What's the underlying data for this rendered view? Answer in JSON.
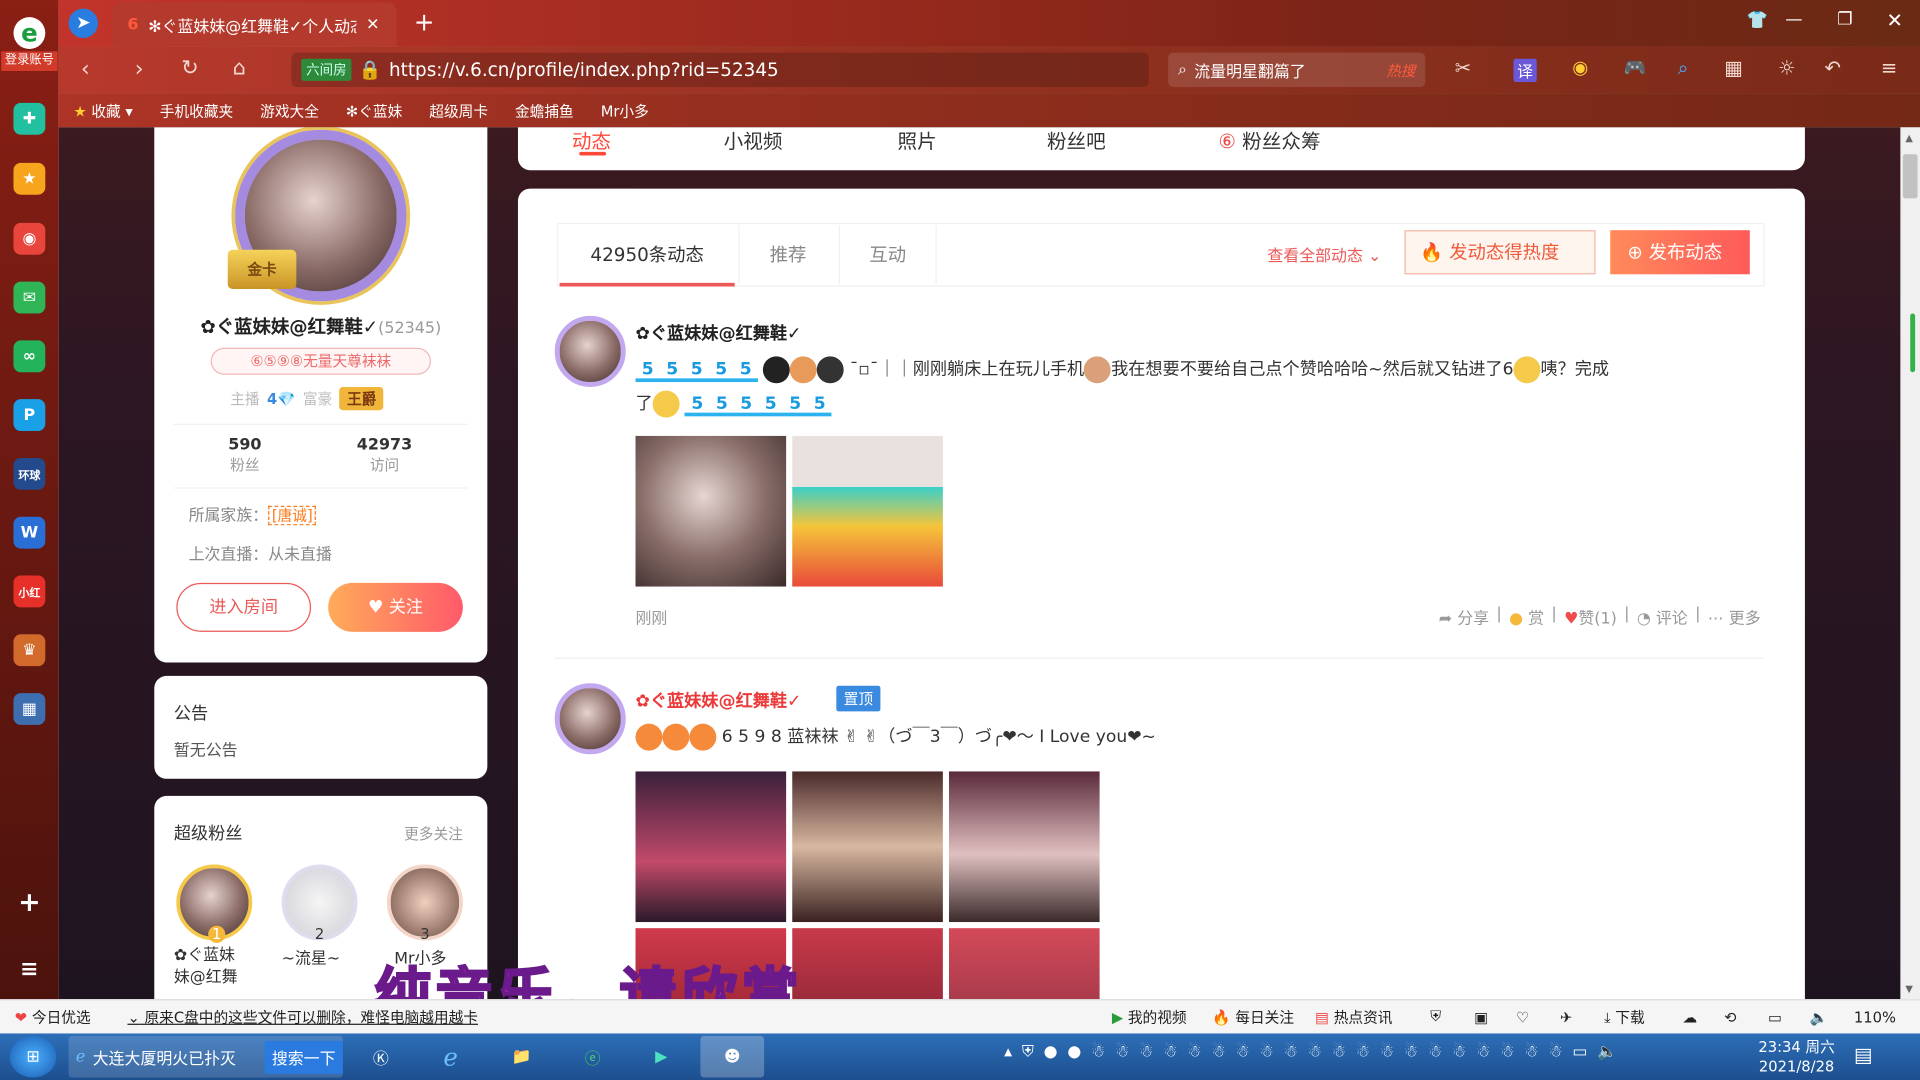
{
  "browser": {
    "side_label": "登录账号",
    "tab_title": "✻ぐ蓝妹妹@红舞鞋✓个人动态",
    "url": "https://v.6.cn/profile/index.php?rid=52345",
    "url_badge": "六间房",
    "search_text": "流量明星翻篇了",
    "search_badge": "热搜",
    "bookmarks": [
      "收藏",
      "手机收藏夹",
      "游戏大全",
      "✻ぐ蓝妹",
      "超级周卡",
      "金蟾捕鱼",
      "Mr小多"
    ]
  },
  "profile": {
    "badge_gold": "金卡",
    "name": "✿ぐ蓝妹妹@红舞鞋✓",
    "rid": "(52345)",
    "title_tag": "⑥⑤⑨⑧无量天尊袜袜",
    "host_label": "主播",
    "host_level": "4",
    "rich_label": "富豪",
    "rich_level": "王爵",
    "fans_count": "590",
    "fans_label": "粉丝",
    "visit_count": "42973",
    "visit_label": "访问",
    "family_label": "所属家族：",
    "family_name": "[唐诚]",
    "last_live": "上次直播：从未直播",
    "enter_room": "进入房间",
    "follow": "关注"
  },
  "notice": {
    "title": "公告",
    "body": "暂无公告"
  },
  "superfans": {
    "title": "超级粉丝",
    "more": "更多关注",
    "items": [
      {
        "rank": "1",
        "name": "✿ぐ蓝妹\n妹@红舞"
      },
      {
        "rank": "2",
        "name": "~流星~"
      },
      {
        "rank": "3",
        "name": "Mr小多"
      }
    ]
  },
  "top_tabs": [
    "动态",
    "小视频",
    "照片",
    "粉丝吧",
    "粉丝众筹"
  ],
  "feed": {
    "tabs": [
      "42950条动态",
      "推荐",
      "互动"
    ],
    "view_all": "查看全部动态",
    "hot_button": "发动态得热度",
    "post_button": "发布动态",
    "posts": [
      {
        "author": "✿ぐ蓝妹妹@红舞鞋✓",
        "text_a": "¯▫¯｜｜刚刚躺床上在玩儿手机",
        "text_b": "我在想要不要给自己点个赞哈哈哈~然后就又钻进了6",
        "text_c": "咦？完成",
        "text_d": "了",
        "time": "刚刚",
        "actions": [
          "分享",
          "赏",
          "赞(1)",
          "评论",
          "更多"
        ]
      },
      {
        "author": "✿ぐ蓝妹妹@红舞鞋✓",
        "pin": "置顶",
        "text": "6 5 9 8 蓝袜袜 ✌ ✌（づ￣3￣）づ╭❤～ I Love you❤~"
      }
    ]
  },
  "overlay_caption": "纯音乐，请欣赏",
  "statusbar": {
    "left": "今日优选",
    "news": "原来C盘中的这些文件可以删除，难怪电脑越用越卡",
    "items": [
      "我的视频",
      "每日关注",
      "热点资讯",
      "下载"
    ],
    "zoom": "110%"
  },
  "taskbar": {
    "ie_title": "大连大厦明火已扑灭",
    "search_btn": "搜索一下",
    "time": "23:34 周六",
    "date": "2021/8/28"
  }
}
